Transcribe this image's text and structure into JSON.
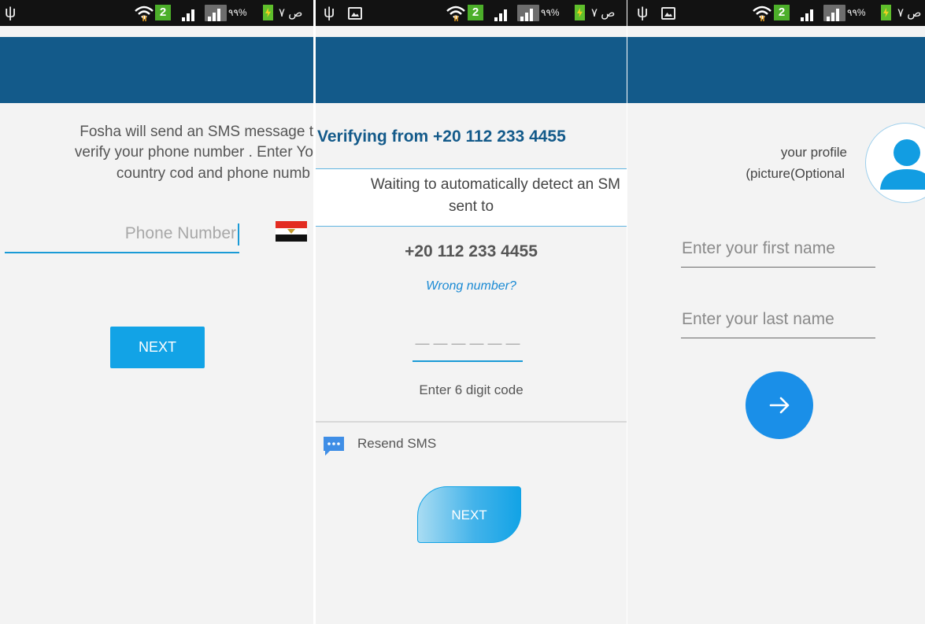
{
  "status_bar": {
    "network_badge": "2",
    "battery_percent": "٩٩%",
    "time_text": "ص ٧"
  },
  "screen1": {
    "instruction_lines": [
      "Fosha will send an SMS message t",
      "verify your phone number . Enter Yo",
      "country cod and phone numb"
    ],
    "phone_placeholder": "Phone Number",
    "next_label": "NEXT"
  },
  "screen2": {
    "verifying_title": "Verifying from +20 112 233 4455",
    "waiting_text": "Waiting to automatically detect an SM",
    "sent_to_text": "sent to",
    "phone_number": "+20 112 233 4455",
    "wrong_number_link": "Wrong number?",
    "code_placeholder": "— — — — — —",
    "code_hint": "Enter 6 digit code",
    "resend_label": "Resend SMS",
    "next_label": "NEXT"
  },
  "screen3": {
    "profile_line1": "your profile",
    "profile_line2": "(picture(Optional",
    "first_name_placeholder": "Enter your first name",
    "last_name_placeholder": "Enter your last name",
    "submit_icon": "arrow-right-icon"
  },
  "colors": {
    "app_bar": "#135a8a",
    "accent": "#12a3e6",
    "title_blue": "#135a8a",
    "link_blue": "#1a8ad4",
    "status_bar": "#121212",
    "background": "#f3f3f3"
  }
}
